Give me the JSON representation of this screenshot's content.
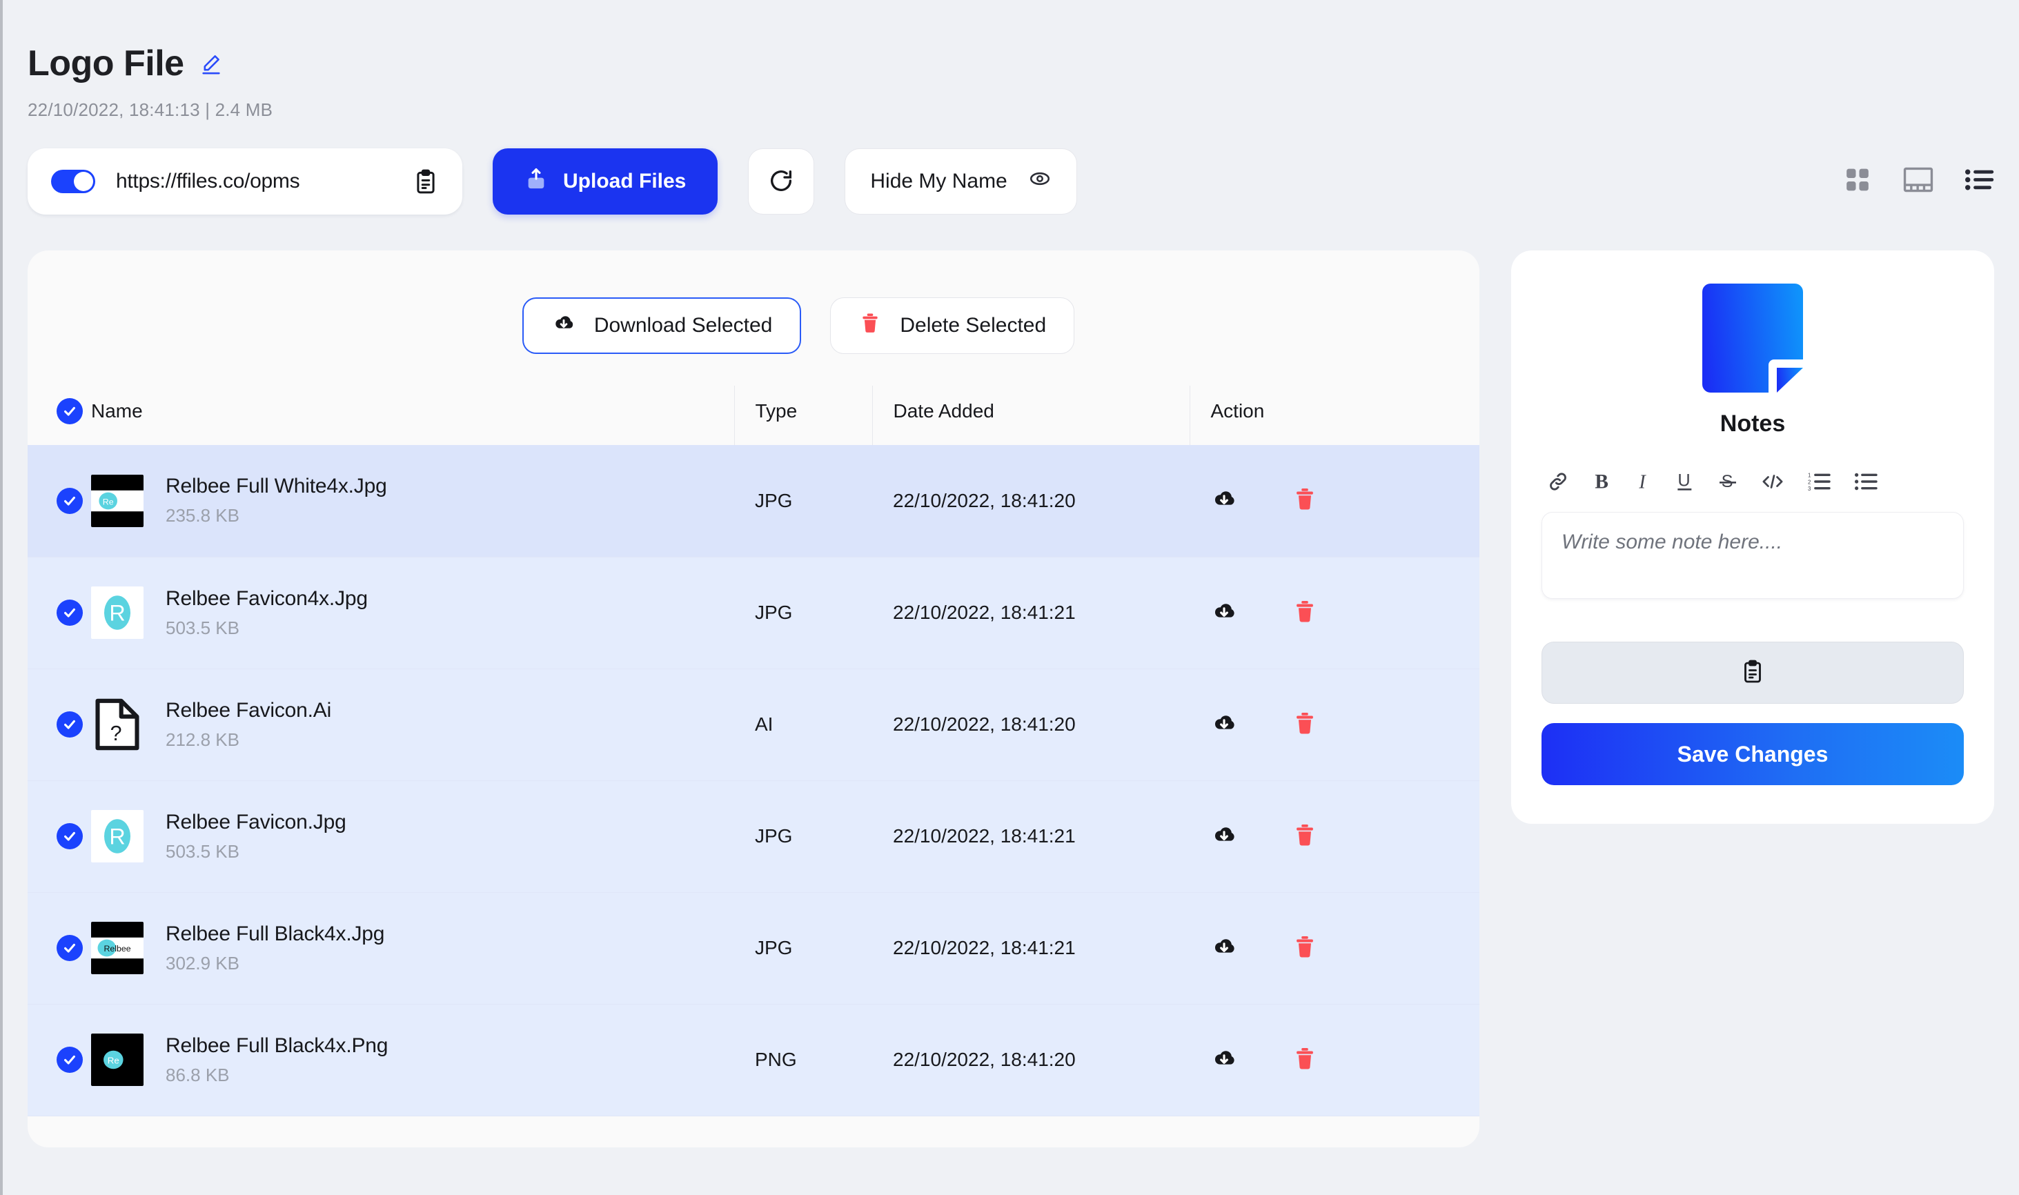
{
  "header": {
    "title": "Logo File",
    "edit_icon": "pencil-icon",
    "meta": "22/10/2022, 18:41:13  |  2.4 MB"
  },
  "toolbar": {
    "share_url": "https://ffiles.co/opms",
    "copy_icon": "clipboard-icon",
    "toggle_on": true,
    "upload_label": "Upload Files",
    "upload_icon": "upload-icon",
    "refresh_icon": "refresh-icon",
    "hide_name_label": "Hide My Name",
    "hide_name_icon": "eye-icon",
    "views": [
      {
        "name": "grid-view",
        "active": false
      },
      {
        "name": "gallery-view",
        "active": false
      },
      {
        "name": "list-view",
        "active": true
      }
    ]
  },
  "files_panel": {
    "download_selected_label": "Download Selected",
    "download_icon": "cloud-download-icon",
    "delete_selected_label": "Delete Selected",
    "delete_icon": "trash-icon",
    "columns": [
      "Name",
      "Type",
      "Date Added",
      "Action"
    ],
    "select_all_checked": true,
    "rows": [
      {
        "name": "Relbee Full White4x.Jpg",
        "size": "235.8 KB",
        "type": "JPG",
        "date": "22/10/2022, 18:41:20",
        "checked": true,
        "active": true,
        "thumb": "black-bars-re"
      },
      {
        "name": "Relbee Favicon4x.Jpg",
        "size": "503.5 KB",
        "type": "JPG",
        "date": "22/10/2022, 18:41:21",
        "checked": true,
        "active": false,
        "thumb": "white-r"
      },
      {
        "name": "Relbee Favicon.Ai",
        "size": "212.8 KB",
        "type": "AI",
        "date": "22/10/2022, 18:41:20",
        "checked": true,
        "active": false,
        "thumb": "doc-question"
      },
      {
        "name": "Relbee Favicon.Jpg",
        "size": "503.5 KB",
        "type": "JPG",
        "date": "22/10/2022, 18:41:21",
        "checked": true,
        "active": false,
        "thumb": "white-r"
      },
      {
        "name": "Relbee Full Black4x.Jpg",
        "size": "302.9 KB",
        "type": "JPG",
        "date": "22/10/2022, 18:41:21",
        "checked": true,
        "active": false,
        "thumb": "black-bars-relbee"
      },
      {
        "name": "Relbee Full Black4x.Png",
        "size": "86.8 KB",
        "type": "PNG",
        "date": "22/10/2022, 18:41:20",
        "checked": true,
        "active": false,
        "thumb": "black-re"
      }
    ]
  },
  "notes": {
    "icon": "note-document-icon",
    "title": "Notes",
    "format_tools": [
      "link-icon",
      "bold-icon",
      "italic-icon",
      "underline-icon",
      "strikethrough-icon",
      "code-icon",
      "ordered-list-icon",
      "unordered-list-icon"
    ],
    "placeholder": "Write some note here....",
    "copy_icon": "clipboard-icon",
    "save_label": "Save Changes"
  },
  "colors": {
    "page_bg": "#eff1f5",
    "primary": "#1b34f0",
    "accent_blue": "#2a5bf7",
    "danger": "#fb4f55",
    "row_bg": "#e4ecfd",
    "row_active_bg": "#dbe4fb",
    "brand_teal": "#5bd3e0"
  }
}
